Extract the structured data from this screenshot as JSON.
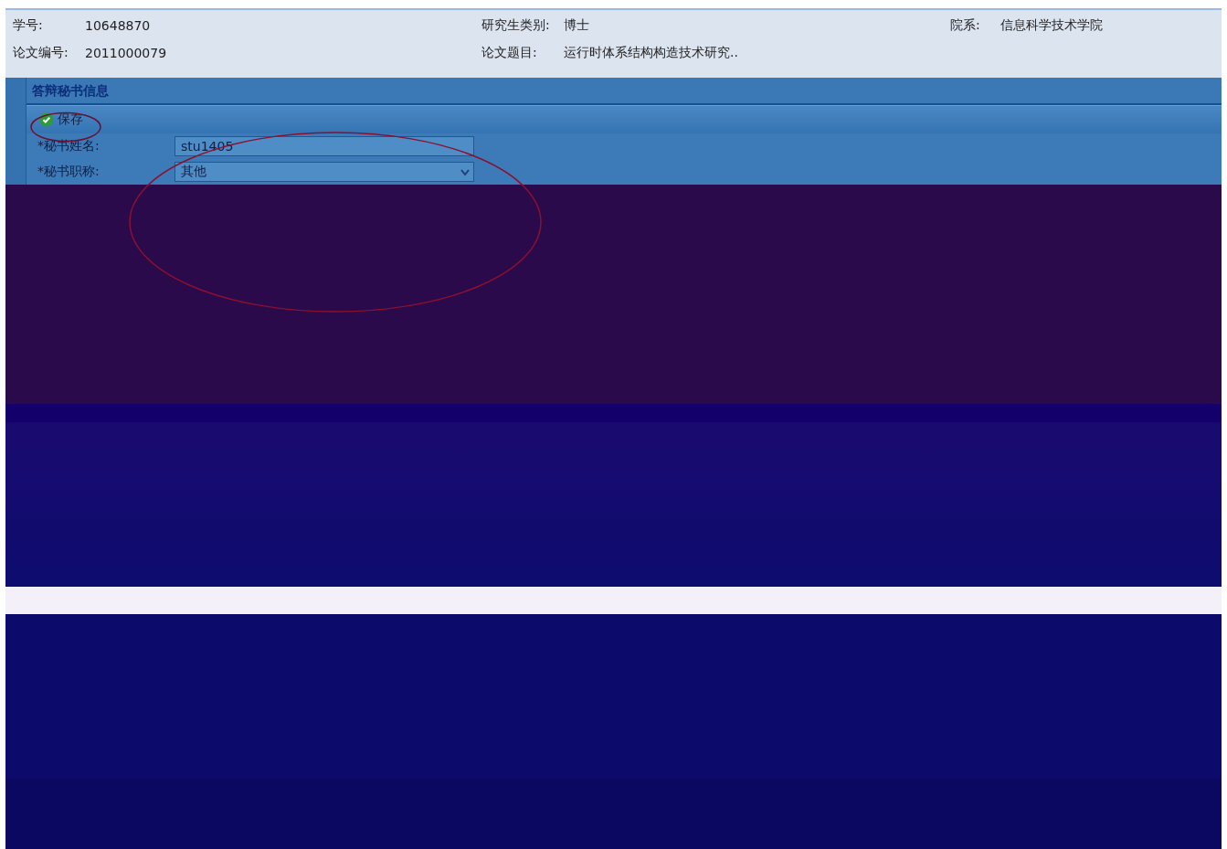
{
  "info": [
    {
      "label": "学号:",
      "value": "10648870"
    },
    {
      "label": "研究生类别:",
      "value": "博士"
    },
    {
      "label": "院系:",
      "value": "信息科学技术学院"
    },
    {
      "label": "论文编号:",
      "value": "2011000079"
    },
    {
      "label": "论文题目:",
      "value": "运行时体系结构构造技术研究.."
    }
  ],
  "panel": {
    "title": "答辩秘书信息",
    "toolbar": [
      {
        "label": "保存"
      }
    ],
    "fields": [
      {
        "kind": "text",
        "label": "*秘书姓名:",
        "value": "stu1405"
      },
      {
        "kind": "select",
        "label": "*秘书职称:",
        "value": "其他"
      }
    ]
  }
}
